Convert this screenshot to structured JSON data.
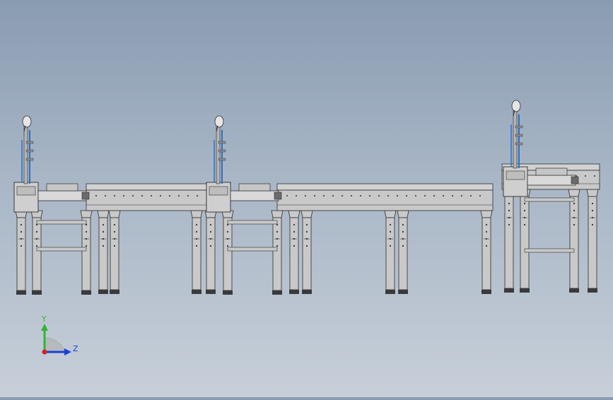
{
  "viewport": {
    "background_top": "#8a9cb2",
    "background_bottom": "#c7cfd9"
  },
  "colors": {
    "frame_fill": "#c9c9c9",
    "frame_stroke": "#2e2e2e",
    "hose_color": "#2e6fc4",
    "axis_y_color": "#2fb62f",
    "axis_z_color": "#1a3fd6",
    "origin_color": "#d42020",
    "plane_fill": "#b7b9bd"
  },
  "triad": {
    "y_label": "Y",
    "z_label": "Z"
  }
}
